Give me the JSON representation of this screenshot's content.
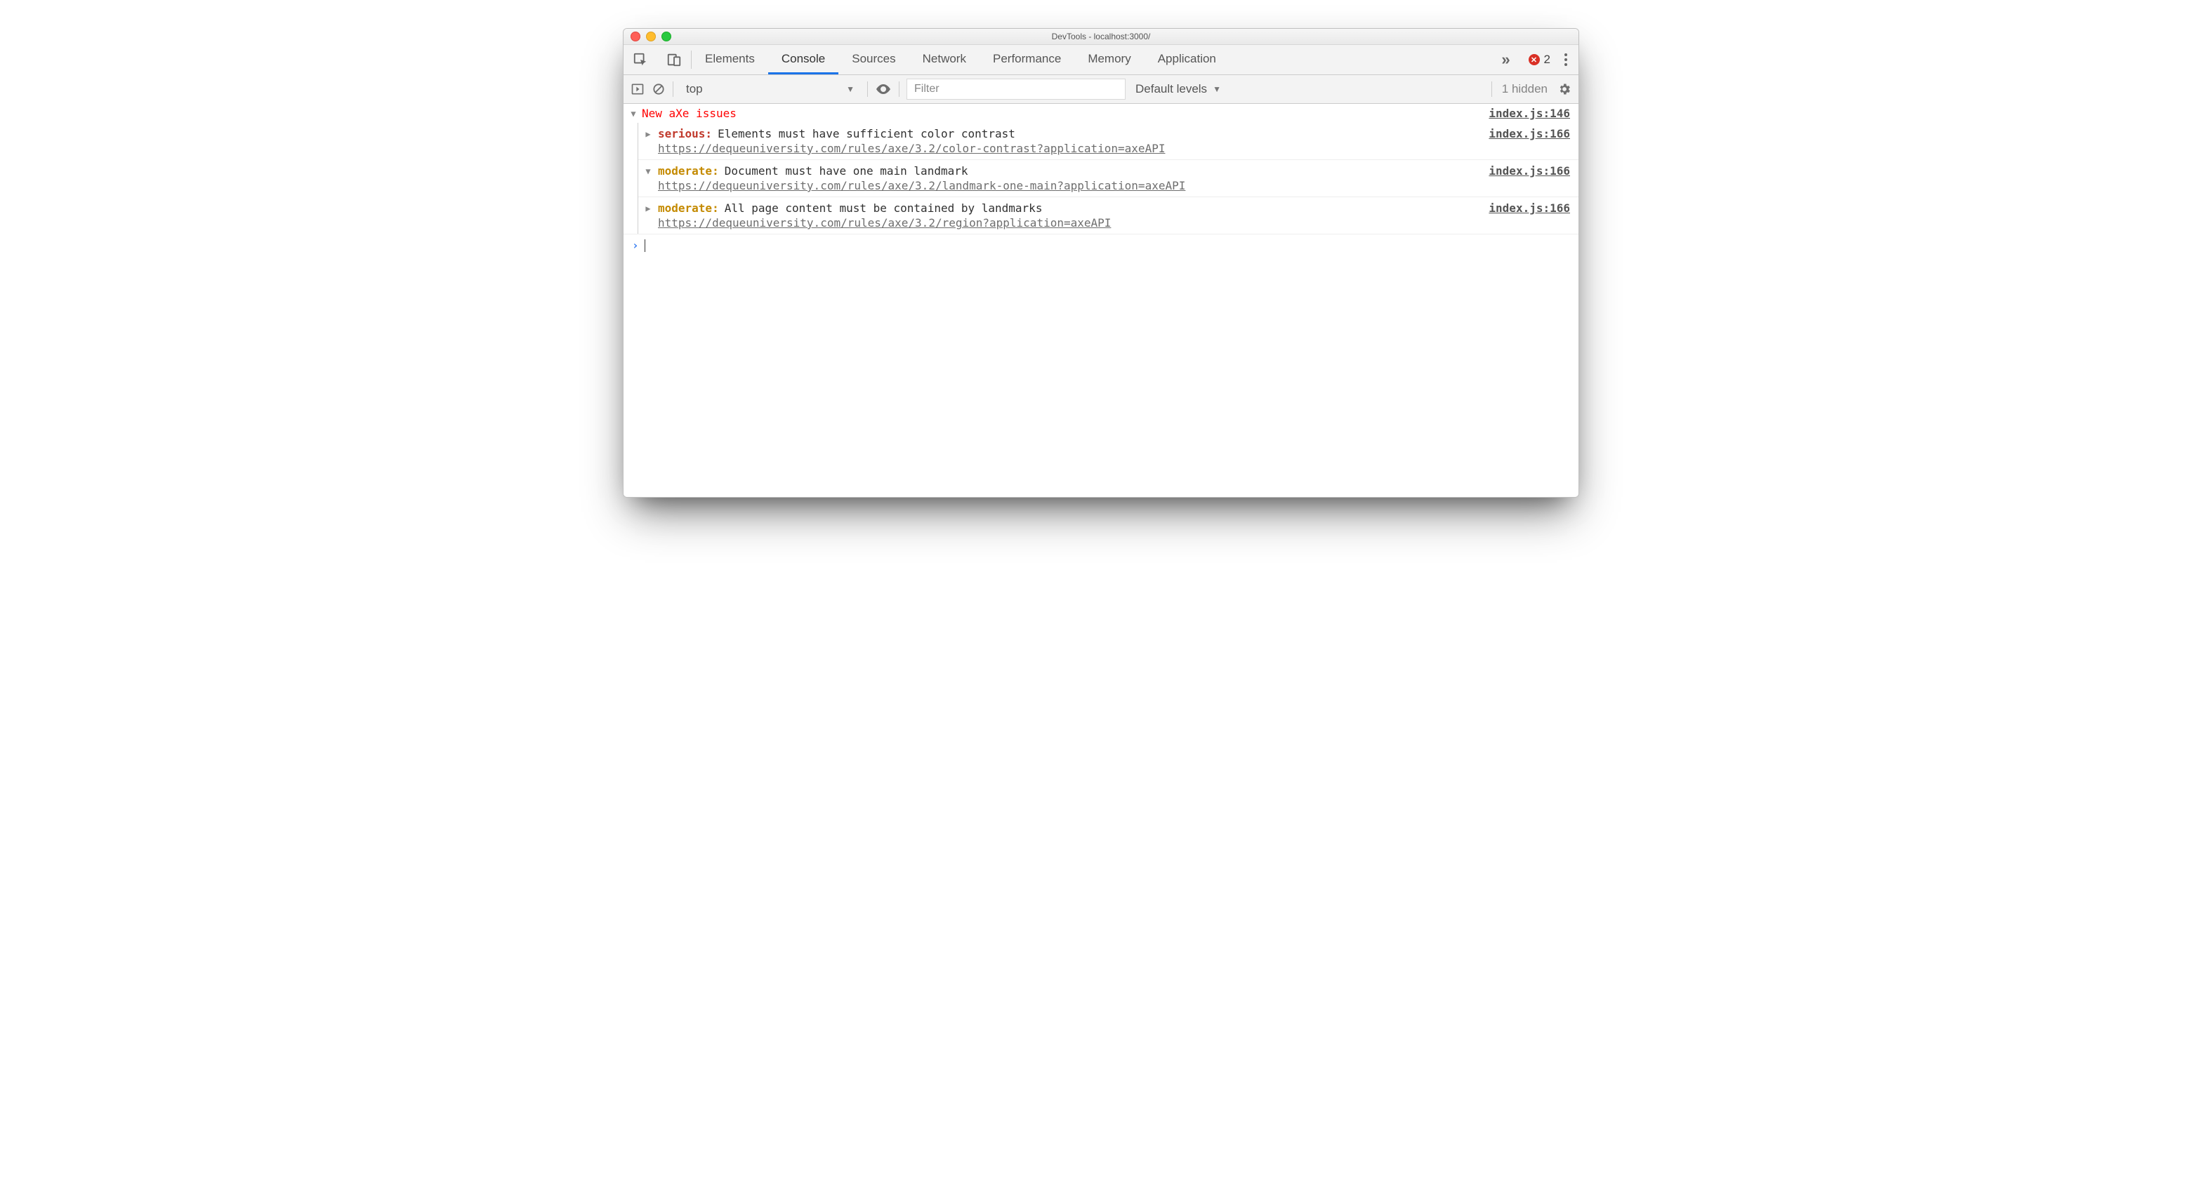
{
  "window": {
    "title": "DevTools - localhost:3000/"
  },
  "tabs": {
    "items": [
      "Elements",
      "Console",
      "Sources",
      "Network",
      "Performance",
      "Memory",
      "Application"
    ],
    "active": "Console",
    "more_icon": "chevron-double-right-icon",
    "error_count": "2"
  },
  "subbar": {
    "context": "top",
    "filter_placeholder": "Filter",
    "levels_label": "Default levels",
    "hidden_label": "1 hidden"
  },
  "console": {
    "group_title": "New aXe issues",
    "group_src": "index.js:146",
    "entries": [
      {
        "expanded": false,
        "severity": "serious",
        "severity_label": "serious:",
        "message": "Elements must have sufficient color contrast",
        "url": "https://dequeuniversity.com/rules/axe/3.2/color-contrast?application=axeAPI",
        "src": "index.js:166"
      },
      {
        "expanded": true,
        "severity": "moderate",
        "severity_label": "moderate:",
        "message": "Document must have one main landmark",
        "url": "https://dequeuniversity.com/rules/axe/3.2/landmark-one-main?application=axeAPI",
        "src": "index.js:166"
      },
      {
        "expanded": false,
        "severity": "moderate",
        "severity_label": "moderate:",
        "message": "All page content must be contained by landmarks",
        "url": "https://dequeuniversity.com/rules/axe/3.2/region?application=axeAPI",
        "src": "index.js:166"
      }
    ]
  }
}
